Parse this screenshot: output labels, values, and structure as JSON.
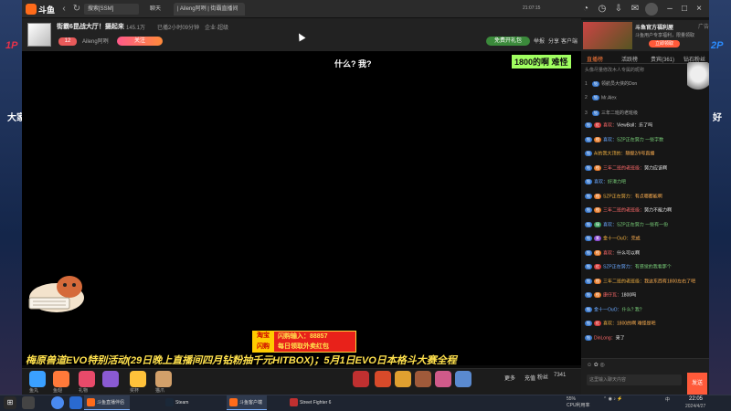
{
  "browser": {
    "logo_text": "斗鱼",
    "address": "搜索[SSM]",
    "tabs": [
      "聊天",
      "| Aileng阿咧 | 街霸直播间",
      "×"
    ],
    "window_time": "21:07:15"
  },
  "room": {
    "title": "街霸6昆战大厅！摄起来",
    "viewers": "145.1万",
    "category": "已播2小时09分钟",
    "tag": "企业·超级",
    "level": "12",
    "host_name": "Aileng阿咧",
    "follow_label": "关注",
    "gift_free_label": "免费开礼包",
    "report_label": "举报",
    "share_label": "分享",
    "fav_label": "客户端"
  },
  "video": {
    "caption": "什么? 我?",
    "danmu_top": "1800的啊 难怪",
    "marquee": "梅原兽道EVO特别活动(29日晚上直播间四月钻粉抽千元HITBOX)；5月1日EVO日本格斗大赛全程",
    "promo_badge": [
      "淘宝",
      "闪购"
    ],
    "promo_line1": "闪购输入：88857",
    "promo_line2": "每日领取外卖红包"
  },
  "gift_bar": {
    "items": [
      "鱼丸",
      "鱼翅",
      "礼物",
      "奖杯",
      "猫爪"
    ],
    "count": "7341",
    "fan_label": "粉丝",
    "recharge_label": "充值",
    "more_label": "更多"
  },
  "right_panel": {
    "ad_title": "斗鱼官方福利屋",
    "ad_sub": "斗鱼用户专享福利，限量领取",
    "ad_button": "立即领取",
    "ad_close": "广告",
    "tabs": [
      "直播榜",
      "活跃榜",
      "贵宾(361)",
      "钻石粉丝"
    ],
    "note": "头像尽量修改木人专属的昵称",
    "rank": [
      {
        "num": "1",
        "badge": "钻",
        "name": "领航员大侠的Don"
      },
      {
        "num": "2",
        "badge": "钻",
        "name": "Mr.Alex"
      },
      {
        "num": "3",
        "badge": "钻",
        "name": "三年二班的老班级"
      }
    ],
    "chat": [
      {
        "badges": [
          "钻",
          "红"
        ],
        "user": "喜欢：",
        "msg": "ViewBall：乐了吗"
      },
      {
        "badges": [
          "钻",
          "橙"
        ],
        "user": "喜欢：",
        "msg": "SZP正在努力 一些字数"
      },
      {
        "badges": [
          "钻"
        ],
        "user": "Ai的我大顶的：",
        "msg": "隔壁2/9号直播"
      },
      {
        "badges": [
          "钻",
          "橙"
        ],
        "user": "三年二班的老班级：",
        "msg": "努力应该啊"
      },
      {
        "badges": [
          "钻"
        ],
        "user": "喜欢：",
        "msg": "好滑力吧"
      },
      {
        "badges": [
          "钻",
          "橙"
        ],
        "user": "SZP正在努力：",
        "msg": "有点哪都能啊"
      },
      {
        "badges": [
          "钻",
          "橙"
        ],
        "user": "三年二班的老班级：",
        "msg": "努力不能力啊"
      },
      {
        "badges": [
          "钻",
          "绿"
        ],
        "user": "喜欢：",
        "msg": "SZP正在努力 一些有一份"
      },
      {
        "badges": [
          "钻",
          "紫"
        ],
        "user": "金十一OuO：",
        "msg": "完成"
      },
      {
        "badges": [
          "钻",
          "橙"
        ],
        "user": "喜欢：",
        "msg": "什么可以啊"
      },
      {
        "badges": [
          "钻",
          "红"
        ],
        "user": "SZP正在努力：",
        "msg": "有感觉的我看那个"
      },
      {
        "badges": [
          "钻",
          "橙"
        ],
        "user": "三年二班的老班级：",
        "msg": "我这东西有1800左右了吧"
      },
      {
        "badges": [
          "钻",
          "橙"
        ],
        "user": "康仔瓦：",
        "msg": "1800吗"
      },
      {
        "badges": [
          "钻"
        ],
        "user": "金十一OuO：",
        "msg": "什么? 我?"
      },
      {
        "badges": [
          "钻",
          "红"
        ],
        "user": "喜欢：",
        "msg": "1800的啊 难怪是吧"
      },
      {
        "badges": [
          "钻"
        ],
        "user": "DinLong：",
        "msg": "来了"
      }
    ],
    "input_placeholder": "这里输入聊天内容",
    "send_label": "发送"
  },
  "taskbar": {
    "apps": [
      "斗鱼直播伴侣",
      "Steam",
      "斗鱼客户端",
      "Street Fighter 6"
    ],
    "cpu_line1": "55%",
    "cpu_line2": "CPU利用率",
    "lang": "中",
    "time": "22:05",
    "date": "2024/4/27"
  },
  "hud": {
    "p1": "1P",
    "p2": "2P",
    "left_label": "大家",
    "right_label": "好"
  }
}
